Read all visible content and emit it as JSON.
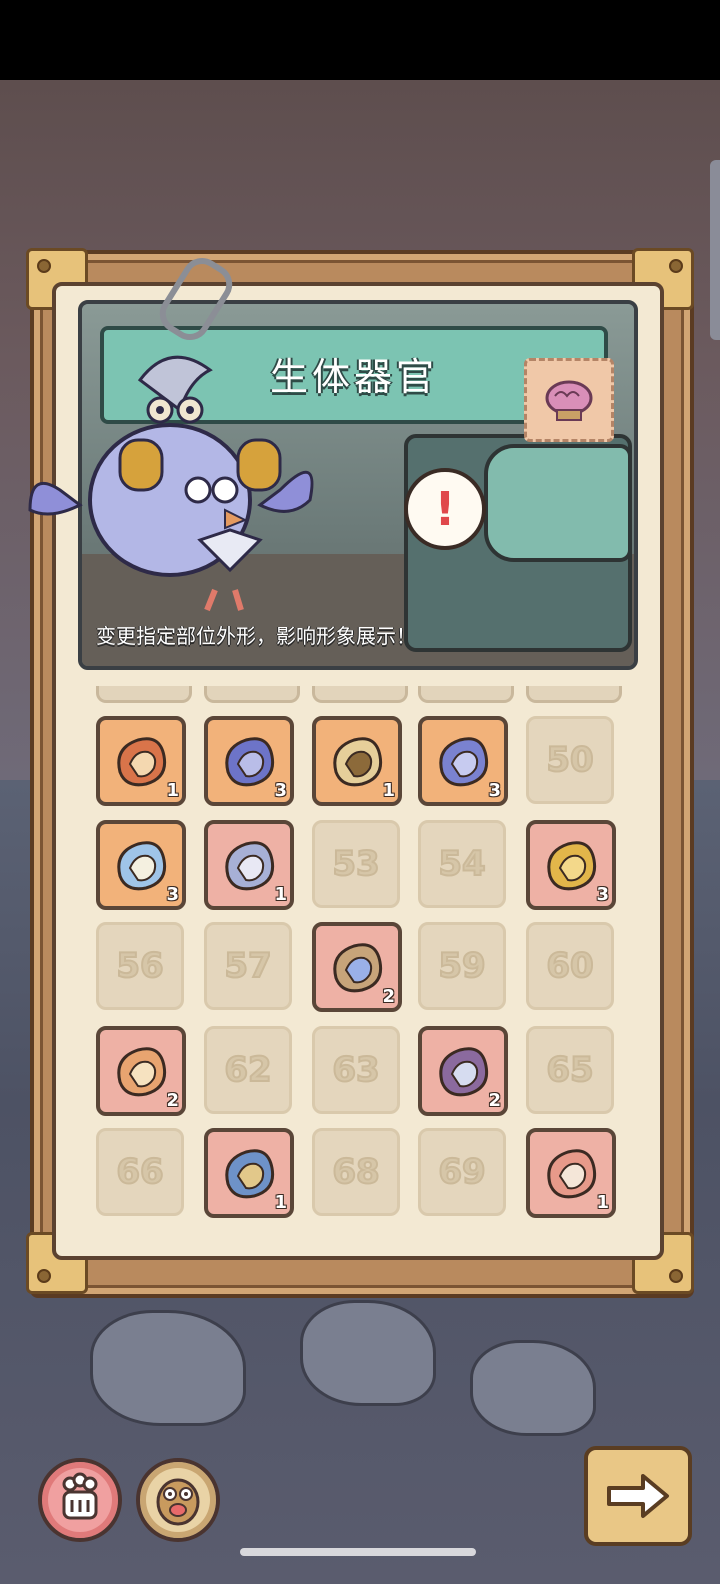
{
  "panel": {
    "title": "生体器官",
    "subtitle": "变更指定部位外形，影响形象展示！",
    "alert_symbol": "!"
  },
  "slots": [
    {
      "id": "47",
      "icon": "organ-mane-icon",
      "count": "1",
      "style": "orange"
    },
    {
      "id": "48",
      "icon": "organ-tentacle-icon",
      "count": "3",
      "style": "orange"
    },
    {
      "id": "49",
      "icon": "organ-fur-icon",
      "count": "1",
      "style": "orange"
    },
    {
      "id": "50a",
      "icon": "organ-fin-icon",
      "count": "3",
      "style": "orange"
    },
    {
      "id": "50",
      "label": "50",
      "style": "empty"
    },
    {
      "id": "51",
      "icon": "organ-eyestalk-icon",
      "count": "3",
      "style": "orange"
    },
    {
      "id": "52",
      "icon": "organ-bat-wing-icon",
      "count": "1",
      "style": "pink"
    },
    {
      "id": "53",
      "label": "53",
      "style": "empty"
    },
    {
      "id": "54",
      "label": "54",
      "style": "empty"
    },
    {
      "id": "55",
      "icon": "organ-eye-shell-icon",
      "count": "3",
      "style": "pink"
    },
    {
      "id": "56",
      "label": "56",
      "style": "empty"
    },
    {
      "id": "57",
      "label": "57",
      "style": "empty"
    },
    {
      "id": "58",
      "icon": "organ-crystal-armor-icon",
      "count": "2",
      "style": "pink"
    },
    {
      "id": "59",
      "label": "59",
      "style": "empty"
    },
    {
      "id": "60",
      "label": "60",
      "style": "empty"
    },
    {
      "id": "61",
      "icon": "organ-claws-icon",
      "count": "2",
      "style": "pink"
    },
    {
      "id": "62",
      "label": "62",
      "style": "empty"
    },
    {
      "id": "63",
      "label": "63",
      "style": "empty"
    },
    {
      "id": "64",
      "icon": "organ-spiked-tail-icon",
      "count": "2",
      "style": "pink"
    },
    {
      "id": "65",
      "label": "65",
      "style": "empty"
    },
    {
      "id": "66",
      "label": "66",
      "style": "empty"
    },
    {
      "id": "67",
      "icon": "organ-armor-plate-icon",
      "count": "1",
      "style": "pink"
    },
    {
      "id": "68",
      "label": "68",
      "style": "empty"
    },
    {
      "id": "69",
      "label": "69",
      "style": "empty"
    },
    {
      "id": "70",
      "icon": "organ-eye-tail-icon",
      "count": "1",
      "style": "pink"
    }
  ],
  "buttons": {
    "organ": "organ-tab-icon",
    "face": "face-tab-icon",
    "next": "arrow-right-icon"
  },
  "colors": {
    "slot_orange": "#f2b27a",
    "slot_pink": "#eeb1a5",
    "title_bar": "#7cc4b2",
    "alert_red": "#e0474b"
  }
}
